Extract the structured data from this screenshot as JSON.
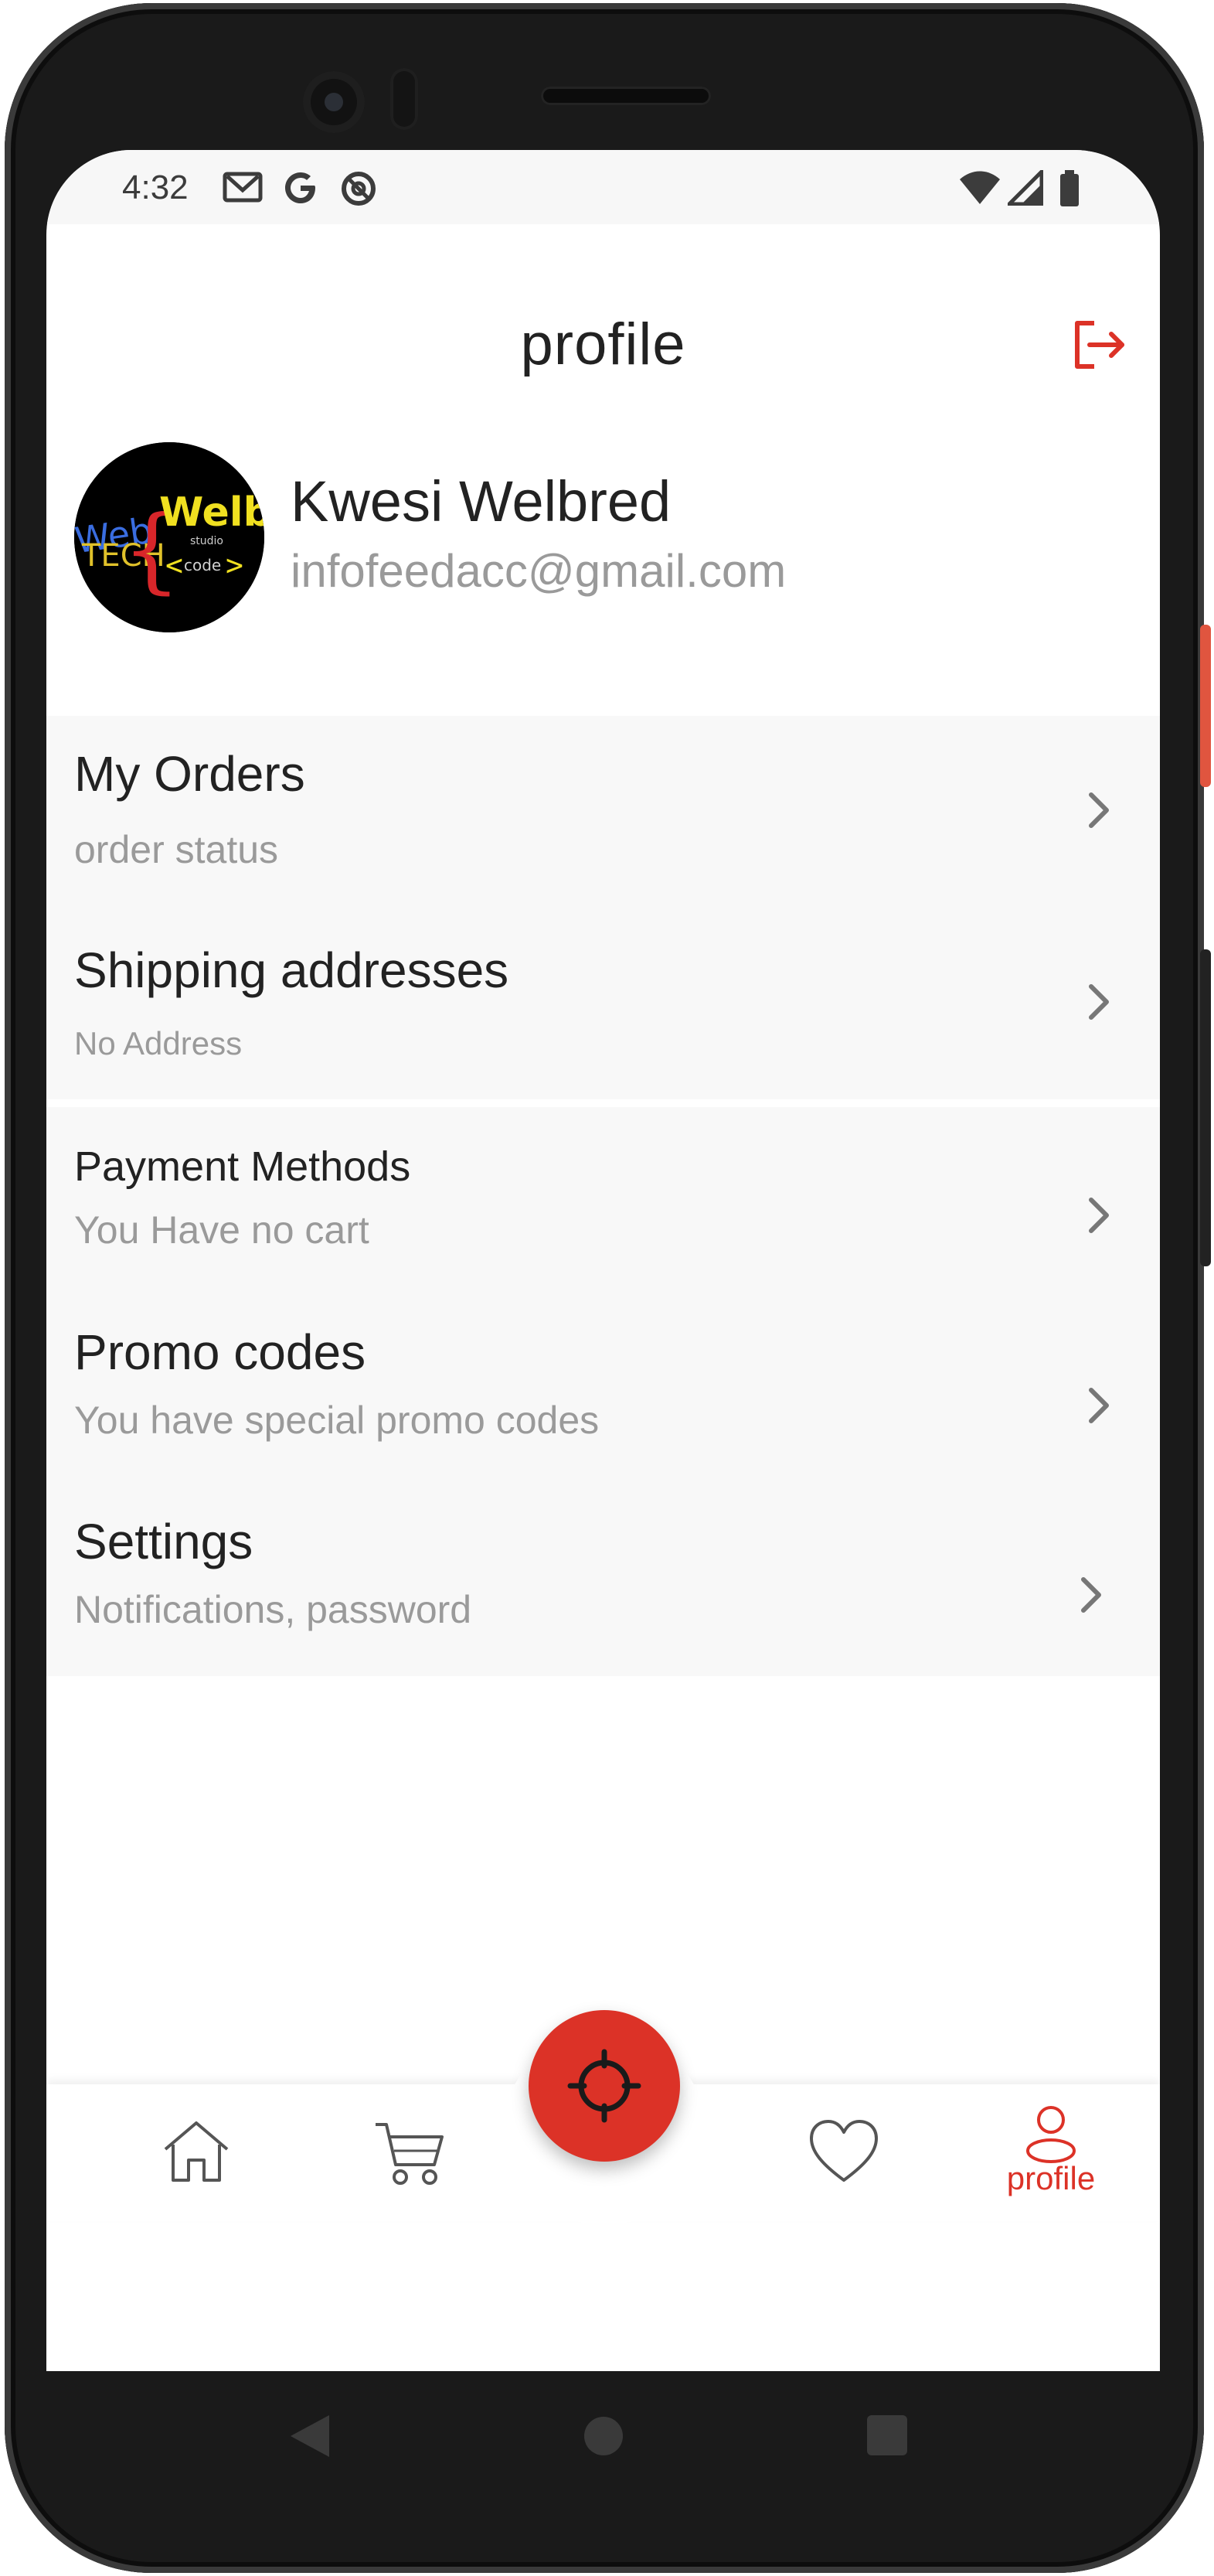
{
  "status_bar": {
    "time": "4:32",
    "icons_left": [
      "gmail-icon",
      "google-icon",
      "data-saver-icon"
    ],
    "icons_right": [
      "wifi-icon",
      "signal-icon",
      "battery-icon"
    ]
  },
  "header": {
    "title": "profile",
    "logout_icon": "logout-icon"
  },
  "profile": {
    "name": "Kwesi Welbred",
    "email": "infofeedacc@gmail.com"
  },
  "menu": [
    {
      "title": "My Orders",
      "subtitle": "order status"
    },
    {
      "title": "Shipping addresses",
      "subtitle": "No Address"
    },
    {
      "title": "Payment Methods",
      "subtitle": "You Have no cart"
    },
    {
      "title": "Promo codes",
      "subtitle": "You have special promo codes"
    },
    {
      "title": "Settings",
      "subtitle": "Notifications, password"
    }
  ],
  "bottom_nav": {
    "items": [
      "home-icon",
      "cart-icon",
      "locate-icon",
      "heart-icon",
      "profile-icon"
    ],
    "active_label": "profile"
  },
  "colors": {
    "accent": "#dc3227",
    "text": "#222222",
    "muted": "#9a9a9a",
    "menu_bg": "#f8f8f8"
  }
}
